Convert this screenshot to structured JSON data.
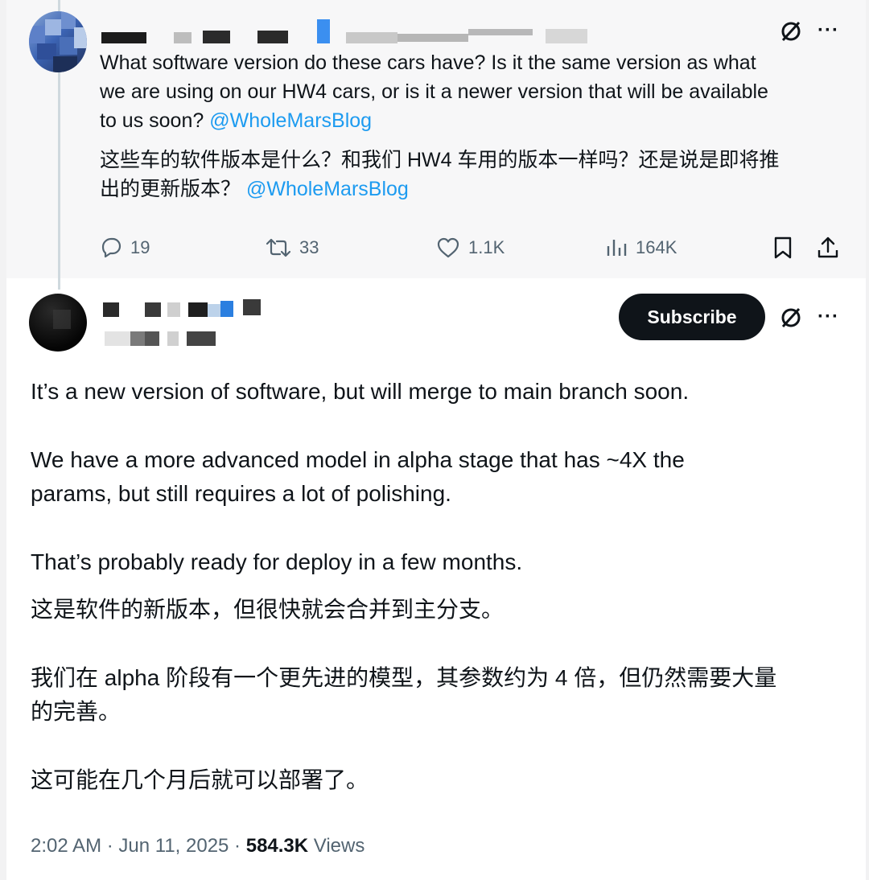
{
  "reply": {
    "text_en_1": "What software version do these cars have?  Is it the same version as what",
    "text_en_2": "we are using on our HW4 cars, or is it a newer version that will be available",
    "text_en_3": "to us soon? ",
    "mention_1": "@WholeMarsBlog",
    "text_zh_1": "这些车的软件版本是什么？和我们 HW4 车用的版本一样吗？还是说是即将推",
    "text_zh_2": "出的更新版本？",
    "mention_2": "@WholeMarsBlog",
    "stats": {
      "replies": "19",
      "reposts": "33",
      "likes": "1.1K",
      "views": "164K"
    },
    "icons": [
      "grok-icon",
      "more-icon",
      "reply-icon",
      "repost-icon",
      "like-icon",
      "views-icon",
      "bookmark-icon",
      "share-icon"
    ]
  },
  "main": {
    "subscribe_label": "Subscribe",
    "para_1": "It’s a new version of software, but will merge to main branch soon.",
    "para_2a": "We have a more advanced model in alpha stage that has ~4X the",
    "para_2b": "params, but still requires a lot of polishing.",
    "para_3": "That’s probably ready for deploy in a few months.",
    "zh_1": "这是软件的新版本，但很快就会合并到主分支。",
    "zh_2a": "我们在 alpha 阶段有一个更先进的模型，其参数约为 4 倍，但仍然需要大量",
    "zh_2b": "的完善。",
    "zh_3": "这可能在几个月后就可以部署了。",
    "time": "2:02 AM · Jun 11, 2025 · ",
    "views_count": "584.3K",
    "views_label": " Views"
  },
  "colors": {
    "mention": "#1d9bf0",
    "secondary_text": "#536471",
    "subscribe_bg": "#0f1419"
  }
}
